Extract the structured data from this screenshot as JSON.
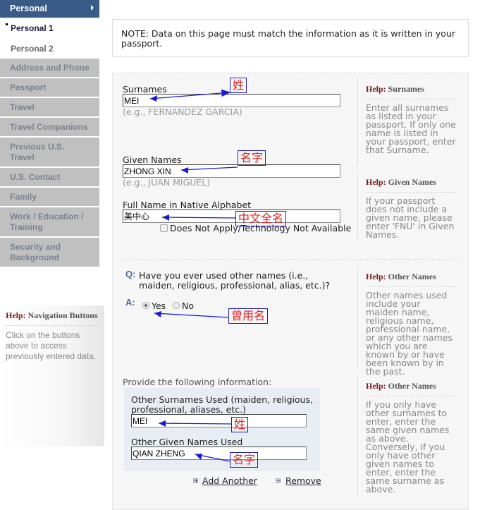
{
  "sidebar": {
    "header": "Personal",
    "subitems": [
      {
        "label": "Personal 1",
        "active": true
      },
      {
        "label": "Personal 2",
        "active": false
      }
    ],
    "items": [
      {
        "label": "Address and Phone"
      },
      {
        "label": "Passport"
      },
      {
        "label": "Travel"
      },
      {
        "label": "Travel Companions"
      },
      {
        "label": "Previous U.S. Travel"
      },
      {
        "label": "U.S. Contact"
      },
      {
        "label": "Family"
      },
      {
        "label": "Work / Education / Training"
      },
      {
        "label": "Security and Background"
      }
    ],
    "help": {
      "keyword": "Help:",
      "title": "Navigation Buttons",
      "text": "Click on the buttons above to access previously entered data."
    }
  },
  "note": "NOTE: Data on this page must match the information as it is written in your passport.",
  "form": {
    "surnames": {
      "label": "Surnames",
      "value": "MEI",
      "example": "(e.g., FERNANDEZ GARCIA)"
    },
    "given_names": {
      "label": "Given Names",
      "value": "ZHONG XIN",
      "example": "(e.g., JUAN MIGUEL)"
    },
    "native_name": {
      "label": "Full Name in Native Alphabet",
      "value": "美中心",
      "checkbox_label": "Does Not Apply/Technology Not Available",
      "checked": false
    },
    "other_names_question": {
      "q_mark": "Q:",
      "a_mark": "A:",
      "text": "Have you ever used other names (i.e., maiden, religious, professional, alias, etc.)?",
      "options": [
        "Yes",
        "No"
      ],
      "selected": "Yes"
    },
    "provide_label": "Provide the following information:",
    "other_surnames": {
      "label": "Other Surnames Used (maiden, religious, professional, aliases, etc.)",
      "value": "MEI"
    },
    "other_given": {
      "label": "Other Given Names Used",
      "value": "QIAN ZHENG"
    },
    "add_another": "Add Another",
    "remove": "Remove"
  },
  "help": [
    {
      "keyword": "Help:",
      "title": "Surnames",
      "text": "Enter all surnames as listed in your passport. If only one name is listed in your passport, enter that Surname."
    },
    {
      "keyword": "Help:",
      "title": "Given Names",
      "text": "If your passport does not include a given name, please enter 'FNU' in Given Names."
    },
    {
      "keyword": "Help:",
      "title": "Other Names",
      "text": "Other names used include your maiden name, religious name, professional name, or any other names which you are known by or have been known by in the past."
    },
    {
      "keyword": "Help:",
      "title": "Other Names",
      "text": "If you only have other surnames to enter, enter the same given names as above. Conversely, if you only have other given names to enter, enter the same surname as above."
    }
  ],
  "annotations": {
    "surname": "姓",
    "given": "名字",
    "native": "中文全名",
    "used_name": "曾用名",
    "other_surname": "姓",
    "other_given": "名字",
    "color_text": "#dd2222",
    "color_arrow": "#1a1ad0"
  }
}
